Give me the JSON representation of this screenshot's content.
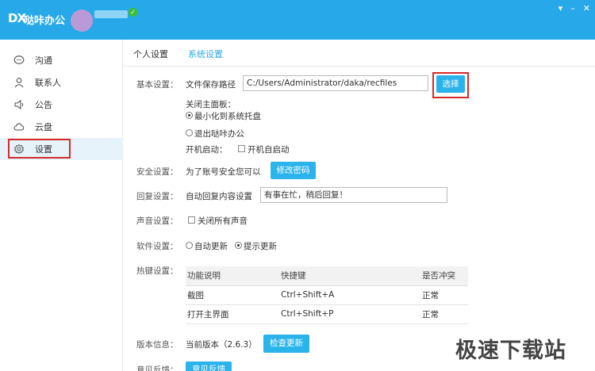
{
  "window": {
    "logo": "DX",
    "title": "哒咔办公",
    "controls": [
      "▾",
      "–",
      "✕"
    ]
  },
  "sidebar": {
    "items": [
      {
        "label": "沟通",
        "icon": "chat-icon"
      },
      {
        "label": "联系人",
        "icon": "person-icon"
      },
      {
        "label": "公告",
        "icon": "speaker-icon"
      },
      {
        "label": "云盘",
        "icon": "cloud-icon"
      },
      {
        "label": "设置",
        "icon": "gear-icon",
        "active": true
      }
    ]
  },
  "tabs": [
    {
      "label": "个人设置",
      "active": true
    },
    {
      "label": "系统设置",
      "active": false
    }
  ],
  "basic": {
    "label": "基本设置：",
    "path_label": "文件保存路径",
    "path_value": "C:/Users/Administrator/daka/recfiles",
    "choose_button": "选择",
    "close_panel_label": "关闭主面板：",
    "minimize_option": "最小化到系统托盘",
    "exit_option": "退出哒咔办公",
    "startup_label": "开机启动：",
    "startup_option": "开机自启动"
  },
  "security": {
    "label": "安全设置：",
    "text": "为了账号安全您可以",
    "button": "修改密码"
  },
  "reply": {
    "label": "回复设置：",
    "text": "自动回复内容设置",
    "value": "有事在忙，稍后回复！"
  },
  "sound": {
    "label": "声音设置：",
    "option": "关闭所有声音"
  },
  "software": {
    "label": "软件设置：",
    "auto_update": "自动更新",
    "prompt_update": "提示更新"
  },
  "hotkeys": {
    "label": "热键设置：",
    "headers": [
      "功能说明",
      "快捷键",
      "是否冲突"
    ],
    "rows": [
      [
        "截图",
        "Ctrl+Shift+A",
        "正常"
      ],
      [
        "打开主界面",
        "Ctrl+Shift+P",
        "正常"
      ]
    ]
  },
  "version": {
    "label": "版本信息：",
    "text": "当前版本（2.6.3）",
    "button": "检查更新"
  },
  "feedback": {
    "label": "意见反馈：",
    "button": "意见反馈"
  },
  "watermark": "极速下载站"
}
